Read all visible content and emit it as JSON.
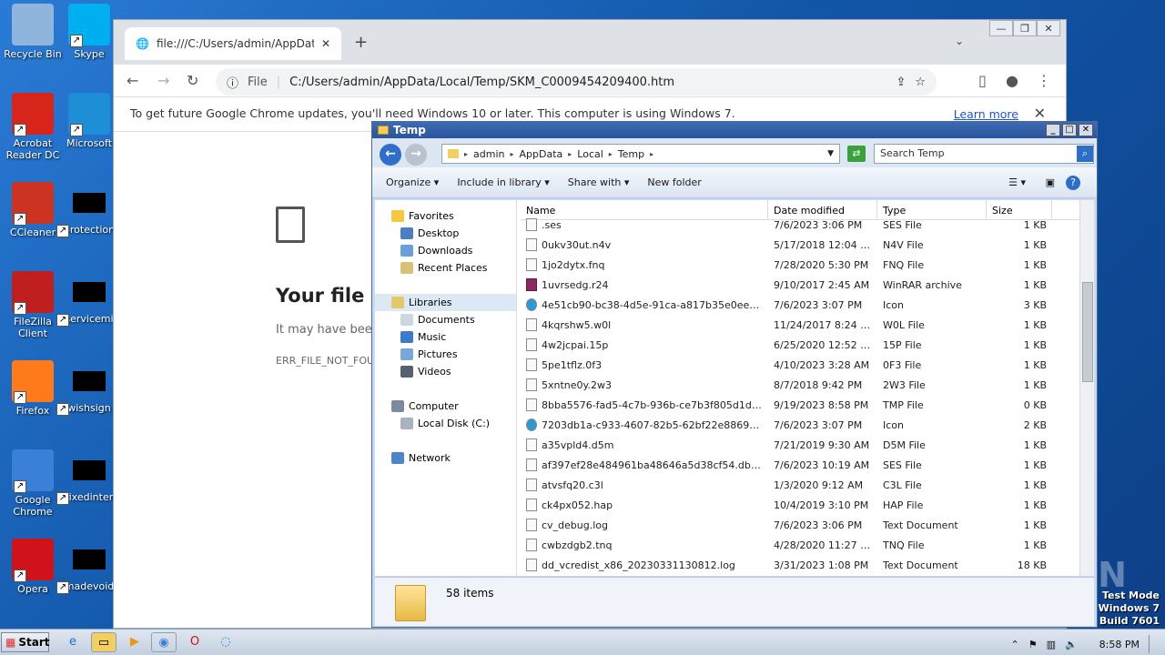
{
  "desktop": {
    "icons": [
      {
        "label": "Recycle Bin",
        "color": "#8fb5dc"
      },
      {
        "label": "Skype",
        "color": "#00aff0"
      },
      {
        "label": "Acrobat Reader DC",
        "color": "#d7251b"
      },
      {
        "label": "Microsoft",
        "color": "#1e8fd6"
      },
      {
        "label": "CCleaner",
        "color": "#cc3322"
      },
      {
        "label": "protection",
        "color": "#000000"
      },
      {
        "label": "FileZilla Client",
        "color": "#bf1f1f"
      },
      {
        "label": "servicemi",
        "color": "#000000"
      },
      {
        "label": "Firefox",
        "color": "#ff7a1a"
      },
      {
        "label": "wishsign",
        "color": "#000000"
      },
      {
        "label": "Google Chrome",
        "color": "#3a7fd8"
      },
      {
        "label": "fixedinter",
        "color": "#000000"
      },
      {
        "label": "Opera",
        "color": "#d0121b"
      },
      {
        "label": "madevoid",
        "color": "#000000"
      }
    ]
  },
  "chrome": {
    "tab_title": "file:///C:/Users/admin/AppData/Loca",
    "address_prefix": "File",
    "address": "C:/Users/admin/AppData/Local/Temp/SKM_C0009454209400.htm",
    "infobar_text": "To get future Google Chrome updates, you'll need Windows 10 or later. This computer is using Windows 7.",
    "learn_more": "Learn more",
    "error_title": "Your file c",
    "error_sub": "It may have been",
    "error_code": "ERR_FILE_NOT_FOU"
  },
  "explorer": {
    "title": "Temp",
    "breadcrumb": [
      "admin",
      "AppData",
      "Local",
      "Temp"
    ],
    "search_placeholder": "Search Temp",
    "commands": [
      "Organize",
      "Include in library",
      "Share with",
      "New folder"
    ],
    "nav": {
      "favorites": "Favorites",
      "favorites_items": [
        "Desktop",
        "Downloads",
        "Recent Places"
      ],
      "libraries": "Libraries",
      "libraries_items": [
        "Documents",
        "Music",
        "Pictures",
        "Videos"
      ],
      "computer": "Computer",
      "computer_items": [
        "Local Disk (C:)"
      ],
      "network": "Network"
    },
    "columns": [
      "Name",
      "Date modified",
      "Type",
      "Size"
    ],
    "files": [
      {
        "name": ".ses",
        "date": "7/6/2023 3:06 PM",
        "type": "SES File",
        "size": "1 KB"
      },
      {
        "name": "0ukv30ut.n4v",
        "date": "5/17/2018 12:04 AM",
        "type": "N4V File",
        "size": "1 KB"
      },
      {
        "name": "1jo2dytx.fnq",
        "date": "7/28/2020 5:30 PM",
        "type": "FNQ File",
        "size": "1 KB"
      },
      {
        "name": "1uvrsedg.r24",
        "date": "9/10/2017 2:45 AM",
        "type": "WinRAR archive",
        "size": "1 KB"
      },
      {
        "name": "4e51cb90-bc38-4d5e-91ca-a817b35e0ee5.t...",
        "date": "7/6/2023 3:07 PM",
        "type": "Icon",
        "size": "3 KB"
      },
      {
        "name": "4kqrshw5.w0l",
        "date": "11/24/2017 8:24 AM",
        "type": "W0L File",
        "size": "1 KB"
      },
      {
        "name": "4w2jcpai.15p",
        "date": "6/25/2020 12:52 AM",
        "type": "15P File",
        "size": "1 KB"
      },
      {
        "name": "5pe1tflz.0f3",
        "date": "4/10/2023 3:28 AM",
        "type": "0F3 File",
        "size": "1 KB"
      },
      {
        "name": "5xntne0y.2w3",
        "date": "8/7/2018 9:42 PM",
        "type": "2W3 File",
        "size": "1 KB"
      },
      {
        "name": "8bba5576-fad5-4c7b-936b-ce7b3f805d1d.tmp",
        "date": "9/19/2023 8:58 PM",
        "type": "TMP File",
        "size": "0 KB"
      },
      {
        "name": "7203db1a-c933-4607-82b5-62bf22e88694.t...",
        "date": "7/6/2023 3:07 PM",
        "type": "Icon",
        "size": "2 KB"
      },
      {
        "name": "a35vpld4.d5m",
        "date": "7/21/2019 9:30 AM",
        "type": "D5M File",
        "size": "1 KB"
      },
      {
        "name": "af397ef28e484961ba48646a5d38cf54.db.ses",
        "date": "7/6/2023 10:19 AM",
        "type": "SES File",
        "size": "1 KB"
      },
      {
        "name": "atvsfq20.c3l",
        "date": "1/3/2020 9:12 AM",
        "type": "C3L File",
        "size": "1 KB"
      },
      {
        "name": "ck4px052.hap",
        "date": "10/4/2019 3:10 PM",
        "type": "HAP File",
        "size": "1 KB"
      },
      {
        "name": "cv_debug.log",
        "date": "7/6/2023 3:06 PM",
        "type": "Text Document",
        "size": "1 KB"
      },
      {
        "name": "cwbzdgb2.tnq",
        "date": "4/28/2020 11:27 PM",
        "type": "TNQ File",
        "size": "1 KB"
      },
      {
        "name": "dd_vcredist_x86_20230331130812.log",
        "date": "3/31/2023 1:08 PM",
        "type": "Text Document",
        "size": "18 KB"
      }
    ],
    "item_count": "58 items"
  },
  "taskbar": {
    "start": "Start",
    "clock": "8:58 PM"
  },
  "watermark": "ANY RUN",
  "testmode": [
    "Test Mode",
    "Windows 7",
    "Build 7601"
  ]
}
